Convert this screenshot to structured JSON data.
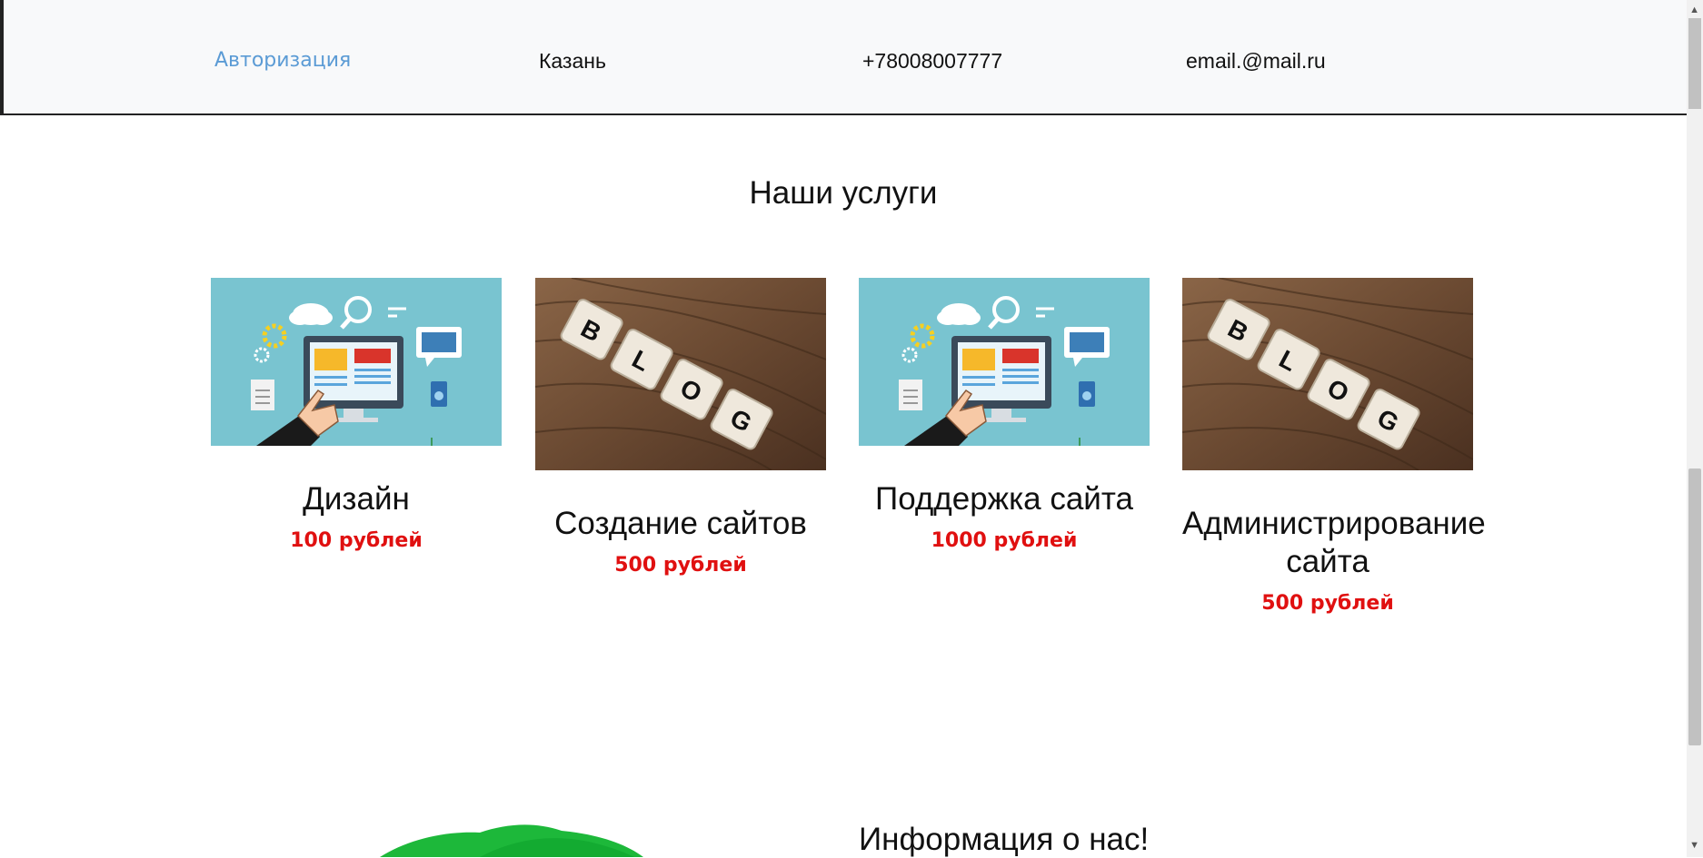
{
  "header": {
    "auth_link": "Авторизация",
    "city": "Казань",
    "phone": "+78008007777",
    "email": "email.@mail.ru"
  },
  "services": {
    "title": "Наши услуги",
    "items": [
      {
        "name": "Дизайн",
        "price": "100 рублей",
        "image": "design-illustration"
      },
      {
        "name": "Создание сайтов",
        "price": "500 рублей",
        "image": "blog-tiles-photo"
      },
      {
        "name": "Поддержка сайта",
        "price": "1000 рублей",
        "image": "design-illustration"
      },
      {
        "name": "Администрирование сайта",
        "price": "500 рублей",
        "image": "blog-tiles-photo"
      }
    ]
  },
  "about": {
    "title": "Информация о нас!"
  },
  "colors": {
    "link": "#5b9bd5",
    "price": "#e01010",
    "header_bg": "#f8f9fa",
    "illustration_bg": "#79c4d0",
    "wood": "#6b4a32"
  }
}
